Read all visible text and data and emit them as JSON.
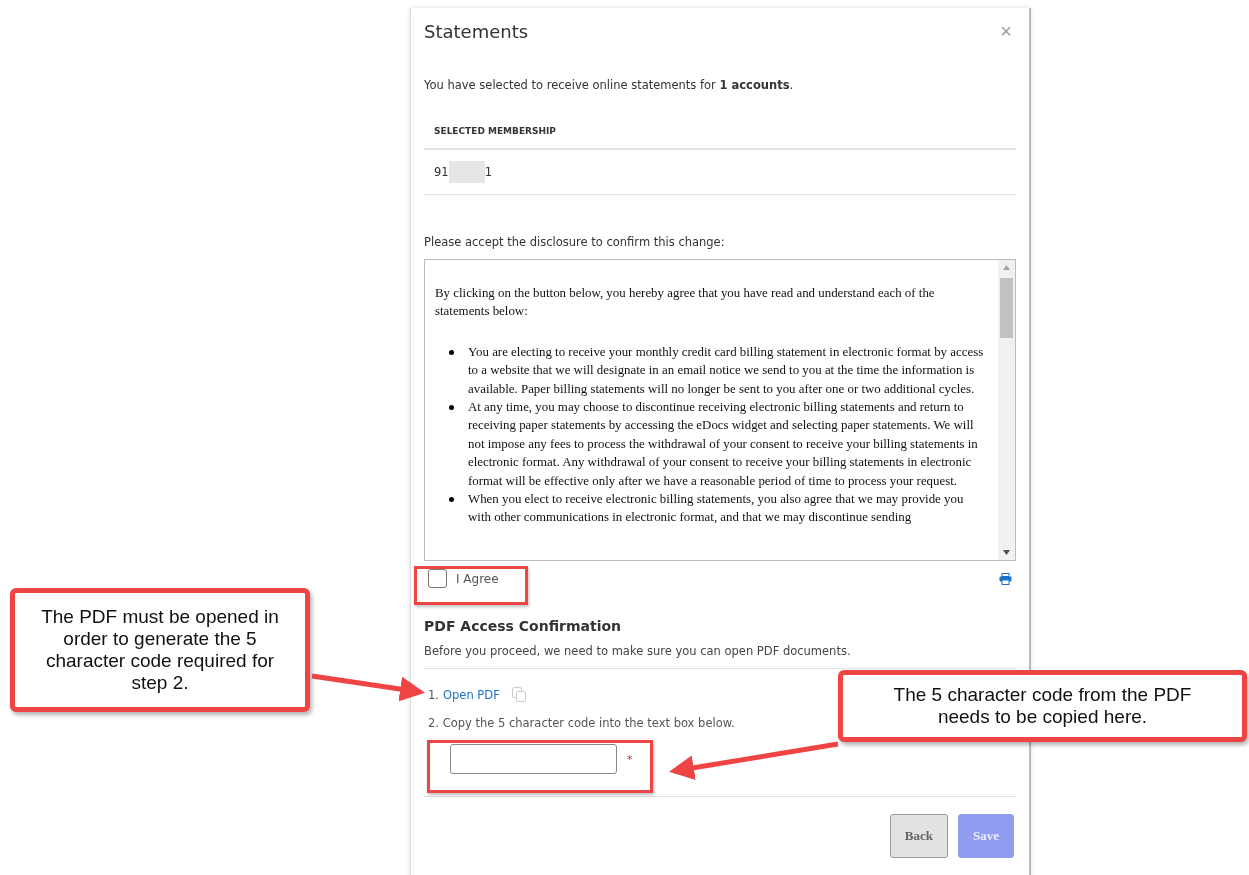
{
  "dialog": {
    "title": "Statements",
    "close": "×",
    "intro": "You have selected to receive online statements for **1 accounts**.",
    "membership": {
      "header": "SELECTED MEMBERSHIP",
      "value_start": "91",
      "value_end": "1"
    },
    "disclosure_prompt": "Please accept the disclosure to confirm this change:",
    "disclosure": {
      "intro": "By clicking on the button below, you hereby agree that you have read and understand each of the statements below:",
      "bullets": [
        "You are electing to receive your monthly credit card billing statement in electronic format by access to a website that we will designate in an email notice we send to you at the time the information is available. Paper billing statements will no longer be sent to you after one or two additional cycles.",
        "At any time, you may choose to discontinue receiving electronic billing statements and return to receiving paper statements by accessing the eDocs widget and selecting paper statements.  We will not impose any fees to process the withdrawal of your consent to receive your billing statements in electronic format.  Any withdrawal of your consent to receive your billing statements in electronic format will be effective only after we have a reasonable period of time to process your request.",
        "When you elect to receive electronic billing statements, you also agree that we may provide you with other communications in electronic format, and that we may discontinue sending"
      ]
    },
    "agree": {
      "label": "I Agree",
      "checked": false
    },
    "pdf": {
      "heading": "PDF Access Confirmation",
      "subtitle": "Before you proceed, we need to make sure you can open PDF documents.",
      "steps": [
        {
          "kind": "link",
          "number": "1.",
          "text": "Open PDF"
        },
        {
          "kind": "text",
          "number": "2.",
          "text": "Copy the 5 character code into the text box below."
        }
      ],
      "code_field": {
        "required_mark": "*"
      }
    },
    "buttons": [
      {
        "label": "Back",
        "disabled": false
      },
      {
        "label": "Save",
        "disabled": true
      }
    ]
  },
  "annotations": [
    {
      "text": "The PDF must be opened in order to generate the 5 character code required for step 2."
    },
    {
      "text": "The 5 character code from the PDF needs to be copied here."
    }
  ]
}
